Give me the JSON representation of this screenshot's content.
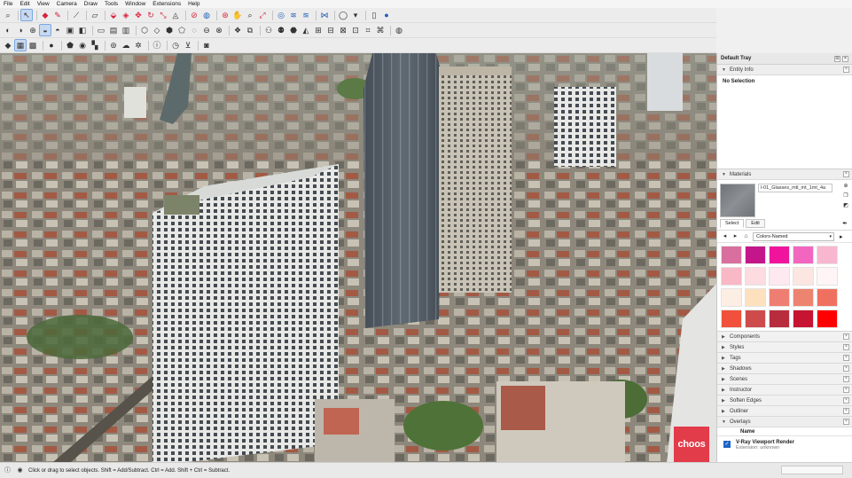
{
  "menu": [
    "File",
    "Edit",
    "View",
    "Camera",
    "Draw",
    "Tools",
    "Window",
    "Extensions",
    "Help"
  ],
  "toolbar_rows": [
    [
      {
        "name": "search-icon",
        "glyph": "⌕"
      },
      {
        "name": "sep"
      },
      {
        "name": "select-tool-icon",
        "glyph": "↖",
        "active": true
      },
      {
        "name": "sep"
      },
      {
        "name": "eraser-icon",
        "glyph": "◆",
        "color": "red"
      },
      {
        "name": "pencil-icon",
        "glyph": "✎",
        "color": "red"
      },
      {
        "name": "sep"
      },
      {
        "name": "line-tool-icon",
        "glyph": "⟋"
      },
      {
        "name": "sep"
      },
      {
        "name": "rectangle-tool-icon",
        "glyph": "▱"
      },
      {
        "name": "sep"
      },
      {
        "name": "push-pull-icon",
        "glyph": "⬙",
        "color": "red"
      },
      {
        "name": "follow-me-icon",
        "glyph": "◈",
        "color": "red"
      },
      {
        "name": "move-icon",
        "glyph": "✥",
        "color": "red"
      },
      {
        "name": "rotate-icon",
        "glyph": "↻",
        "color": "red"
      },
      {
        "name": "scale-icon",
        "glyph": "⤡",
        "color": "red"
      },
      {
        "name": "offset-icon",
        "glyph": "◬"
      },
      {
        "name": "sep"
      },
      {
        "name": "tape-measure-icon",
        "glyph": "⊘",
        "color": "red"
      },
      {
        "name": "paint-bucket-icon",
        "glyph": "◍",
        "color": "blue"
      },
      {
        "name": "sep"
      },
      {
        "name": "orbit-icon",
        "glyph": "⊛",
        "color": "red"
      },
      {
        "name": "pan-icon",
        "glyph": "✋"
      },
      {
        "name": "zoom-icon",
        "glyph": "⌕"
      },
      {
        "name": "zoom-extents-icon",
        "glyph": "⤢",
        "color": "red"
      },
      {
        "name": "sep"
      },
      {
        "name": "sandbox-icon",
        "glyph": "◎",
        "color": "blue"
      },
      {
        "name": "layers-icon",
        "glyph": "≋",
        "color": "blue"
      },
      {
        "name": "stack-icon",
        "glyph": "≊",
        "color": "blue"
      },
      {
        "name": "sep"
      },
      {
        "name": "extension-warehouse-icon",
        "glyph": "⋈",
        "color": "blue"
      },
      {
        "name": "sep"
      },
      {
        "name": "account-icon",
        "glyph": "◯"
      },
      {
        "name": "dropdown-icon",
        "glyph": "▾"
      },
      {
        "name": "sep"
      },
      {
        "name": "document-icon",
        "glyph": "▯"
      },
      {
        "name": "user-icon",
        "glyph": "●",
        "color": "blue"
      }
    ],
    [
      {
        "name": "xray-icon",
        "glyph": "◐"
      },
      {
        "name": "back-edges-icon",
        "glyph": "◑"
      },
      {
        "name": "wireframe-icon",
        "glyph": "⊕"
      },
      {
        "name": "hidden-line-icon",
        "glyph": "◒",
        "active": true
      },
      {
        "name": "shaded-icon",
        "glyph": "◓"
      },
      {
        "name": "textured-icon",
        "glyph": "▣"
      },
      {
        "name": "monochrome-icon",
        "glyph": "◧"
      },
      {
        "name": "sep"
      },
      {
        "name": "section-plane-icon",
        "glyph": "▭"
      },
      {
        "name": "section-cut-icon",
        "glyph": "▤"
      },
      {
        "name": "section-fill-icon",
        "glyph": "▥"
      },
      {
        "name": "sep"
      },
      {
        "name": "iso-view-icon",
        "glyph": "⬡"
      },
      {
        "name": "top-view-icon",
        "glyph": "◇"
      },
      {
        "name": "front-view-icon",
        "glyph": "⬢"
      },
      {
        "name": "right-view-icon",
        "glyph": "⬠"
      },
      {
        "name": "back-view-icon",
        "glyph": "◌"
      },
      {
        "name": "left-view-icon",
        "glyph": "⊖"
      },
      {
        "name": "bottom-view-icon",
        "glyph": "⊗"
      },
      {
        "name": "sep"
      },
      {
        "name": "component-icon",
        "glyph": "❖"
      },
      {
        "name": "group-icon",
        "glyph": "⧉"
      },
      {
        "name": "sep"
      },
      {
        "name": "camera-position-icon",
        "glyph": "⚇"
      },
      {
        "name": "walk-icon",
        "glyph": "⚉"
      },
      {
        "name": "look-around-icon",
        "glyph": "⬣"
      },
      {
        "name": "sandbox-from-contours-icon",
        "glyph": "◭"
      },
      {
        "name": "sandbox-scratch-icon",
        "glyph": "⊞"
      },
      {
        "name": "smoove-icon",
        "glyph": "⊟"
      },
      {
        "name": "stamp-icon",
        "glyph": "⊠"
      },
      {
        "name": "drape-icon",
        "glyph": "⊡"
      },
      {
        "name": "add-detail-icon",
        "glyph": "⌗"
      },
      {
        "name": "flip-edge-icon",
        "glyph": "⌘"
      },
      {
        "name": "sep"
      },
      {
        "name": "geo-location-icon",
        "glyph": "◍"
      }
    ],
    [
      {
        "name": "vray-logo-icon",
        "glyph": "◆"
      },
      {
        "name": "render-icon",
        "glyph": "▦",
        "active": true
      },
      {
        "name": "interactive-render-icon",
        "glyph": "▩"
      },
      {
        "name": "sep"
      },
      {
        "name": "asset-editor-icon",
        "glyph": "●"
      },
      {
        "name": "sep"
      },
      {
        "name": "frame-buffer-icon",
        "glyph": "⬟"
      },
      {
        "name": "light-gen-icon",
        "glyph": "◉"
      },
      {
        "name": "batch-render-icon",
        "glyph": "▚"
      },
      {
        "name": "sep"
      },
      {
        "name": "chaos-cloud-icon",
        "glyph": "⊚"
      },
      {
        "name": "cloud-icon",
        "glyph": "☁"
      },
      {
        "name": "settings-icon",
        "glyph": "✲"
      },
      {
        "name": "sep"
      },
      {
        "name": "help-icon",
        "glyph": "ⓘ"
      },
      {
        "name": "sep"
      },
      {
        "name": "clock-icon",
        "glyph": "◷"
      },
      {
        "name": "cart-icon",
        "glyph": "⊻"
      },
      {
        "name": "sep"
      },
      {
        "name": "profile-icon",
        "glyph": "◙"
      }
    ]
  ],
  "tray": {
    "title": "Default Tray",
    "entity_info": {
      "title": "Entity Info",
      "value": "No Selection"
    },
    "materials": {
      "title": "Materials",
      "name": "l-01_Glasses_mtl_mt_1mt_4a",
      "tabs": [
        "Select",
        "Edit"
      ],
      "library": "Colors-Named",
      "colors": [
        "#d96f9e",
        "#c4168a",
        "#f0149d",
        "#f266bf",
        "#f8b6cf",
        "#f9b8c6",
        "#fcdbe1",
        "#fde9ef",
        "#fce6e1",
        "#fff5f7",
        "#fdeee4",
        "#fde1bf",
        "#ef7e72",
        "#ed8470",
        "#f07060",
        "#f0503c",
        "#cd4b4b",
        "#b82d3e",
        "#c71432",
        "#ff0000"
      ]
    },
    "panels": [
      "Components",
      "Styles",
      "Tags",
      "Shadows",
      "Scenes",
      "Instructor",
      "Soften Edges",
      "Outliner"
    ],
    "overlays": {
      "title": "Overlays",
      "column": "Name",
      "item": {
        "name": "V-Ray Viewport Render",
        "sub": "Extension: unknown"
      }
    }
  },
  "status": {
    "text": "Click or drag to select objects. Shift = Add/Subtract. Ctrl = Add. Shift + Ctrl = Subtract."
  },
  "watermark": "choos"
}
